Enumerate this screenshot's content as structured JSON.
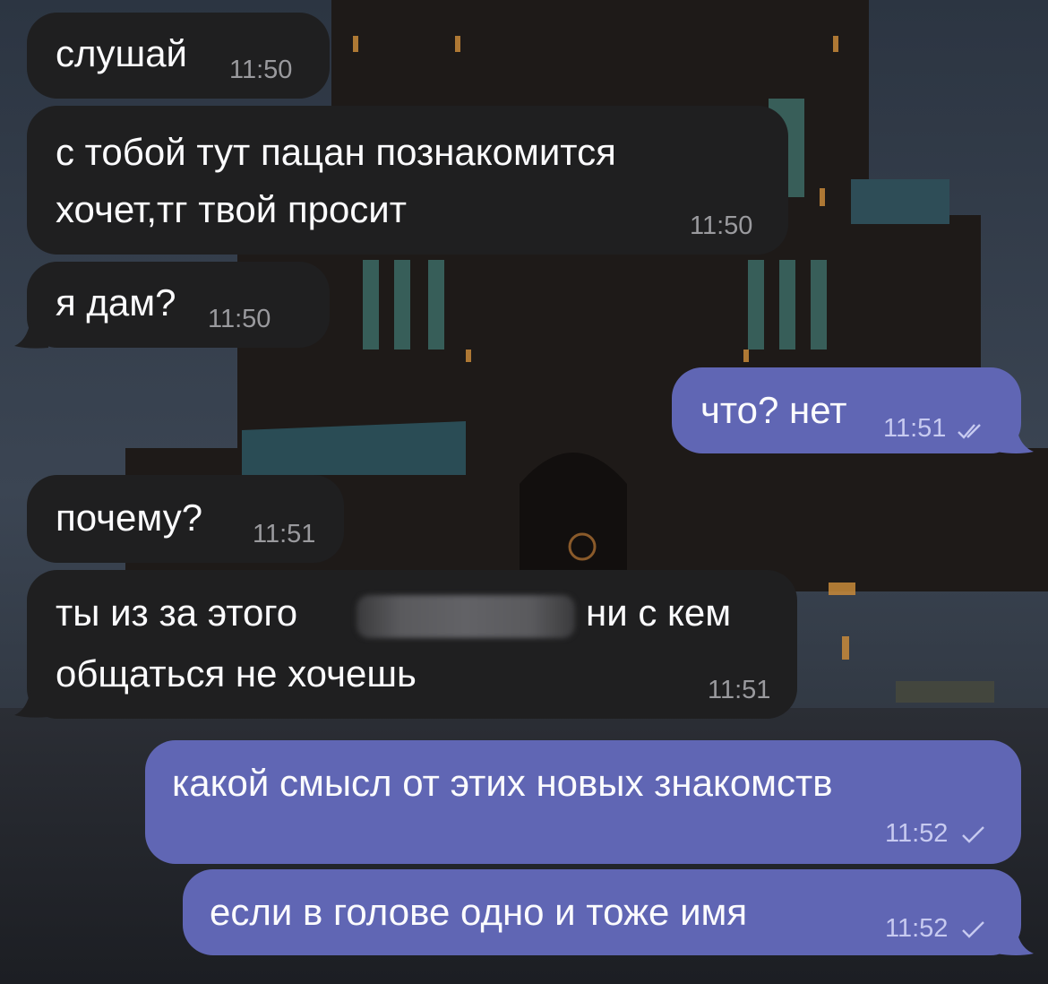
{
  "chat": {
    "messages": [
      {
        "direction": "incoming",
        "text": "слушай",
        "time": "11:50"
      },
      {
        "direction": "incoming",
        "lines": [
          "с тобой тут пацан познакомится",
          "хочет,тг твой просит"
        ],
        "time": "11:50"
      },
      {
        "direction": "incoming",
        "text": "я дам?",
        "time": "11:50"
      },
      {
        "direction": "outgoing",
        "text": "что? нет",
        "time": "11:51",
        "status": "read"
      },
      {
        "direction": "incoming",
        "text": "почему?",
        "time": "11:51"
      },
      {
        "direction": "incoming",
        "lines": [
          "ты из за этого",
          "ни с кем",
          "общаться не хочешь"
        ],
        "time": "11:51",
        "has_redaction": true
      },
      {
        "direction": "outgoing",
        "text": "какой смысл от этих новых знакомств",
        "time": "11:52",
        "status": "sent"
      },
      {
        "direction": "outgoing",
        "text": "если в голове одно и тоже имя",
        "time": "11:52",
        "status": "sent"
      }
    ]
  },
  "colors": {
    "incoming_bubble": "#1f1f20",
    "outgoing_bubble": "#6066b4",
    "text": "#fbfbfd",
    "incoming_time": "#9a9a9e",
    "outgoing_time": "#c7caf0"
  },
  "icons": {
    "read_status": "double-check-icon",
    "sent_status": "check-icon"
  }
}
